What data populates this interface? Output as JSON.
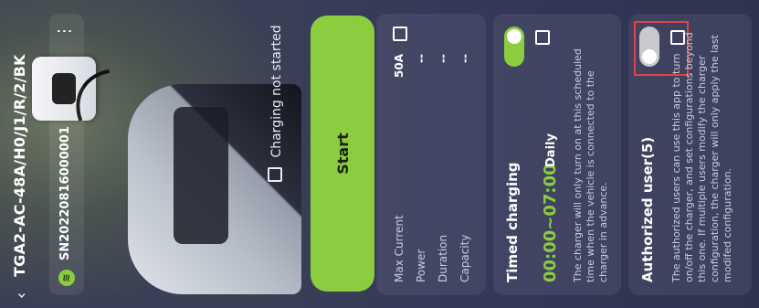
{
  "header": {
    "title": "TGA2-AC-48A/H0/J1/R/2/BK",
    "serial": "SN20220816000001",
    "back_icon": "chevron-left-icon",
    "menu_icon": "more-vertical-icon",
    "wifi_icon": "wifi-icon"
  },
  "status": {
    "text": "Charging not started",
    "icon": "info-icon"
  },
  "actions": {
    "start_label": "Start",
    "accent": "#8ccc3f"
  },
  "stats": {
    "rows": [
      {
        "label": "Max Current",
        "value": "50A"
      },
      {
        "label": "Power",
        "value": "--"
      },
      {
        "label": "Duration",
        "value": "--"
      },
      {
        "label": "Capacity",
        "value": "--"
      }
    ]
  },
  "timed": {
    "title": "Timed charging",
    "time": "00:00~07:00",
    "repeat": "Daily",
    "description": "The charger will only turn on at this scheduled time when the vehicle is connected to the charger in advance.",
    "enabled": true
  },
  "authorized": {
    "title": "Authorized user(5)",
    "description": "The authorized users can use this app to turn on/off the charger, and set configurations beyond this one. If multiple users modify the charger configuration, the charger will only apply the last modifed configuration.",
    "enabled": false
  }
}
